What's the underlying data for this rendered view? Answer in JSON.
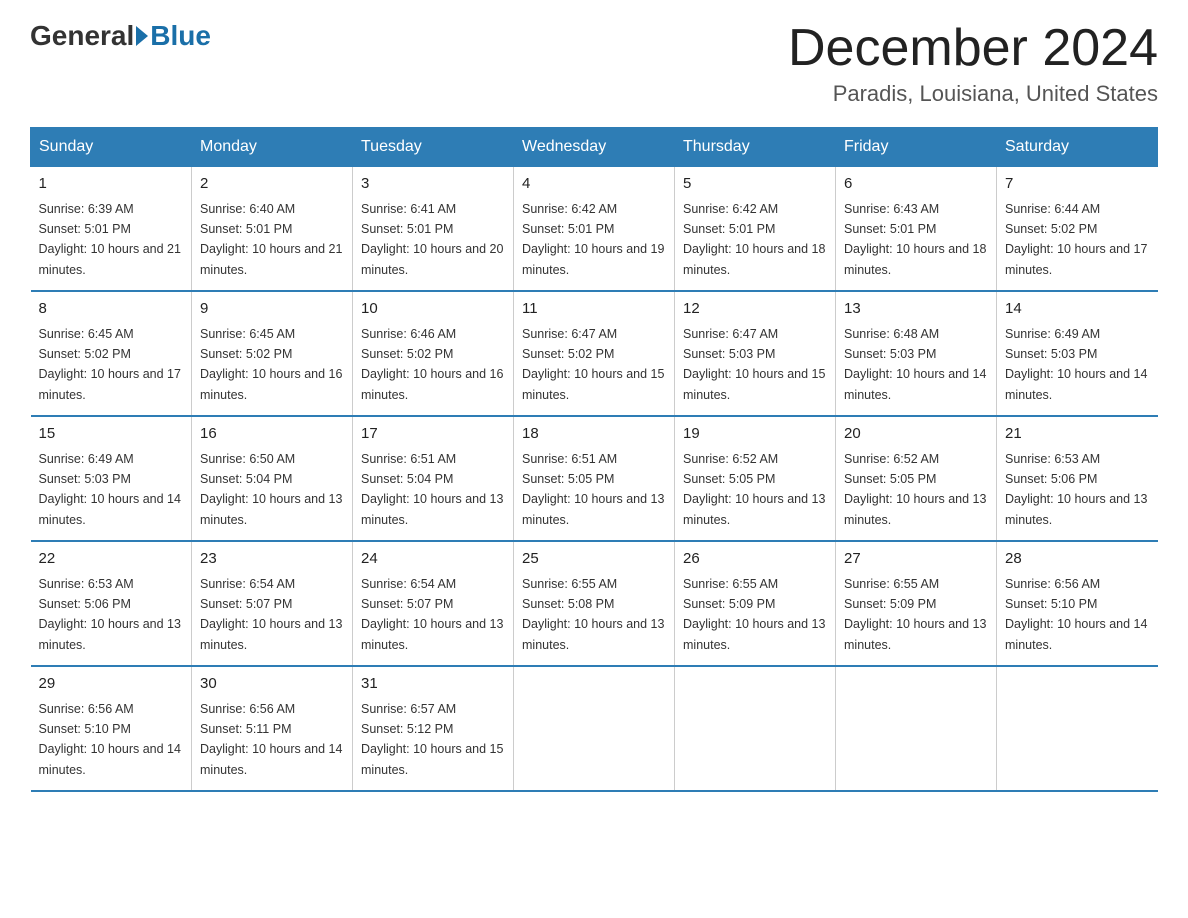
{
  "logo": {
    "general": "General",
    "blue": "Blue"
  },
  "title": "December 2024",
  "subtitle": "Paradis, Louisiana, United States",
  "days_of_week": [
    "Sunday",
    "Monday",
    "Tuesday",
    "Wednesday",
    "Thursday",
    "Friday",
    "Saturday"
  ],
  "weeks": [
    [
      {
        "day": "1",
        "sunrise": "6:39 AM",
        "sunset": "5:01 PM",
        "daylight": "10 hours and 21 minutes."
      },
      {
        "day": "2",
        "sunrise": "6:40 AM",
        "sunset": "5:01 PM",
        "daylight": "10 hours and 21 minutes."
      },
      {
        "day": "3",
        "sunrise": "6:41 AM",
        "sunset": "5:01 PM",
        "daylight": "10 hours and 20 minutes."
      },
      {
        "day": "4",
        "sunrise": "6:42 AM",
        "sunset": "5:01 PM",
        "daylight": "10 hours and 19 minutes."
      },
      {
        "day": "5",
        "sunrise": "6:42 AM",
        "sunset": "5:01 PM",
        "daylight": "10 hours and 18 minutes."
      },
      {
        "day": "6",
        "sunrise": "6:43 AM",
        "sunset": "5:01 PM",
        "daylight": "10 hours and 18 minutes."
      },
      {
        "day": "7",
        "sunrise": "6:44 AM",
        "sunset": "5:02 PM",
        "daylight": "10 hours and 17 minutes."
      }
    ],
    [
      {
        "day": "8",
        "sunrise": "6:45 AM",
        "sunset": "5:02 PM",
        "daylight": "10 hours and 17 minutes."
      },
      {
        "day": "9",
        "sunrise": "6:45 AM",
        "sunset": "5:02 PM",
        "daylight": "10 hours and 16 minutes."
      },
      {
        "day": "10",
        "sunrise": "6:46 AM",
        "sunset": "5:02 PM",
        "daylight": "10 hours and 16 minutes."
      },
      {
        "day": "11",
        "sunrise": "6:47 AM",
        "sunset": "5:02 PM",
        "daylight": "10 hours and 15 minutes."
      },
      {
        "day": "12",
        "sunrise": "6:47 AM",
        "sunset": "5:03 PM",
        "daylight": "10 hours and 15 minutes."
      },
      {
        "day": "13",
        "sunrise": "6:48 AM",
        "sunset": "5:03 PM",
        "daylight": "10 hours and 14 minutes."
      },
      {
        "day": "14",
        "sunrise": "6:49 AM",
        "sunset": "5:03 PM",
        "daylight": "10 hours and 14 minutes."
      }
    ],
    [
      {
        "day": "15",
        "sunrise": "6:49 AM",
        "sunset": "5:03 PM",
        "daylight": "10 hours and 14 minutes."
      },
      {
        "day": "16",
        "sunrise": "6:50 AM",
        "sunset": "5:04 PM",
        "daylight": "10 hours and 13 minutes."
      },
      {
        "day": "17",
        "sunrise": "6:51 AM",
        "sunset": "5:04 PM",
        "daylight": "10 hours and 13 minutes."
      },
      {
        "day": "18",
        "sunrise": "6:51 AM",
        "sunset": "5:05 PM",
        "daylight": "10 hours and 13 minutes."
      },
      {
        "day": "19",
        "sunrise": "6:52 AM",
        "sunset": "5:05 PM",
        "daylight": "10 hours and 13 minutes."
      },
      {
        "day": "20",
        "sunrise": "6:52 AM",
        "sunset": "5:05 PM",
        "daylight": "10 hours and 13 minutes."
      },
      {
        "day": "21",
        "sunrise": "6:53 AM",
        "sunset": "5:06 PM",
        "daylight": "10 hours and 13 minutes."
      }
    ],
    [
      {
        "day": "22",
        "sunrise": "6:53 AM",
        "sunset": "5:06 PM",
        "daylight": "10 hours and 13 minutes."
      },
      {
        "day": "23",
        "sunrise": "6:54 AM",
        "sunset": "5:07 PM",
        "daylight": "10 hours and 13 minutes."
      },
      {
        "day": "24",
        "sunrise": "6:54 AM",
        "sunset": "5:07 PM",
        "daylight": "10 hours and 13 minutes."
      },
      {
        "day": "25",
        "sunrise": "6:55 AM",
        "sunset": "5:08 PM",
        "daylight": "10 hours and 13 minutes."
      },
      {
        "day": "26",
        "sunrise": "6:55 AM",
        "sunset": "5:09 PM",
        "daylight": "10 hours and 13 minutes."
      },
      {
        "day": "27",
        "sunrise": "6:55 AM",
        "sunset": "5:09 PM",
        "daylight": "10 hours and 13 minutes."
      },
      {
        "day": "28",
        "sunrise": "6:56 AM",
        "sunset": "5:10 PM",
        "daylight": "10 hours and 14 minutes."
      }
    ],
    [
      {
        "day": "29",
        "sunrise": "6:56 AM",
        "sunset": "5:10 PM",
        "daylight": "10 hours and 14 minutes."
      },
      {
        "day": "30",
        "sunrise": "6:56 AM",
        "sunset": "5:11 PM",
        "daylight": "10 hours and 14 minutes."
      },
      {
        "day": "31",
        "sunrise": "6:57 AM",
        "sunset": "5:12 PM",
        "daylight": "10 hours and 15 minutes."
      },
      null,
      null,
      null,
      null
    ]
  ]
}
